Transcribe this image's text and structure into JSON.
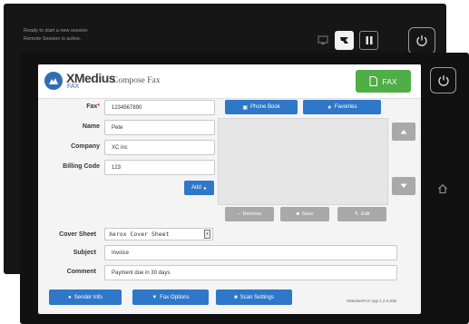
{
  "back_screen": {
    "status_line1": "Ready to start a new session",
    "status_line2": "Remote Session is active."
  },
  "app": {
    "logo_text": "XMedius",
    "logo_sub": "FAX",
    "title": "Compose Fax",
    "fax_button": "FAX"
  },
  "form": {
    "fax_label": "Fax",
    "fax_required": "*",
    "fax_value": "1234567890",
    "name_label": "Name",
    "name_value": "Pete",
    "company_label": "Company",
    "company_value": "XC inc",
    "billing_label": "Billing Code",
    "billing_value": "123",
    "add_button": "Add",
    "cover_label": "Cover Sheet",
    "cover_value": "Xerox Cover Sheet",
    "subject_label": "Subject",
    "subject_value": "Invoice",
    "comment_label": "Comment",
    "comment_value": "Payment due in 30 days"
  },
  "recipients": {
    "phone_book": "Phone Book",
    "favorites": "Favorites",
    "remove": "Remove",
    "save": "Save",
    "edit": "Edit"
  },
  "footer": {
    "sender_info": "Sender Info",
    "fax_options": "Fax Options",
    "scan_settings": "Scan Settings",
    "version": "XMediusFAX App 1.2.0.838"
  },
  "colors": {
    "brand_blue": "#2f77c8",
    "fax_green": "#4fae45",
    "gray_button": "#a9a9a9",
    "device_body": "#111111"
  },
  "icons": [
    "pause-icon",
    "power-icon",
    "home-icon",
    "fax-document-icon",
    "phone-book-icon",
    "star-icon",
    "scroll-up-icon",
    "scroll-down-icon"
  ]
}
